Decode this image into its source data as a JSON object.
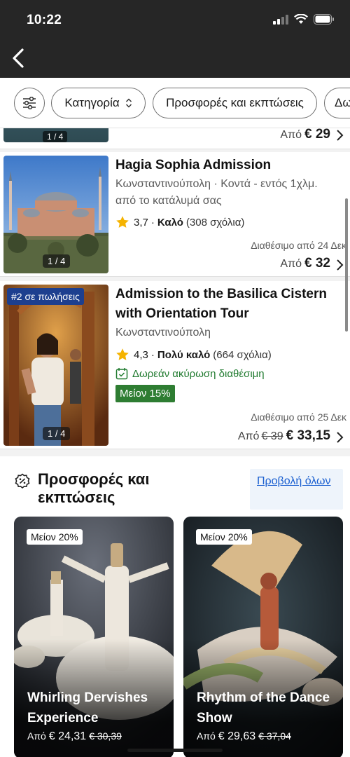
{
  "status_bar": {
    "time": "10:22"
  },
  "filters": {
    "category": "Κατηγορία",
    "offers": "Προσφορές και εκπτώσεις",
    "more": "Δω"
  },
  "list": {
    "partial_item": {
      "count": "1 / 4",
      "price_prefix": "Από",
      "price": "€ 29"
    },
    "items": [
      {
        "title": "Hagia Sophia Admission",
        "location": "Κωνσταντινούπολη · Κοντά - εντός 1χλμ. από το κατάλυμά σας",
        "rating": "3,7",
        "rating_word": "Καλό",
        "reviews": "(308 σχόλια)",
        "photo_count": "1 / 4",
        "availability": "Διαθέσιμο από 24 Δεκ",
        "price_prefix": "Από",
        "price": "€ 32"
      },
      {
        "badge": "#2 σε πωλήσεις",
        "title": "Admission to the Basilica Cistern with Orientation Tour",
        "location": "Κωνσταντινούπολη",
        "rating": "4,3",
        "rating_word": "Πολύ καλό",
        "reviews": "(664 σχόλια)",
        "free_cancel": "Δωρεάν ακύρωση διαθέσιμη",
        "discount": "Μείον 15%",
        "photo_count": "1 / 4",
        "availability": "Διαθέσιμο από 25 Δεκ",
        "price_prefix": "Από",
        "old_price": "€ 39",
        "price": "€ 33,15"
      }
    ]
  },
  "offers": {
    "title": "Προσφορές και εκπτώσεις",
    "view_all": "Προβολή όλων",
    "deals": [
      {
        "badge": "Μείον 20%",
        "title": "Whirling Dervishes Experience",
        "price_prefix": "Από",
        "price": "€ 24,31",
        "old_price": "€ 30,39"
      },
      {
        "badge": "Μείον 20%",
        "title": "Rhythm of the Dance Show",
        "price_prefix": "Από",
        "price": "€ 29,63",
        "old_price": "€ 37,04"
      }
    ]
  },
  "colors": {
    "header": "#262626",
    "accent_green": "#2e7d32",
    "rank_badge": "#1d3f8f",
    "link": "#1a5fd0",
    "star": "#f5b301"
  }
}
